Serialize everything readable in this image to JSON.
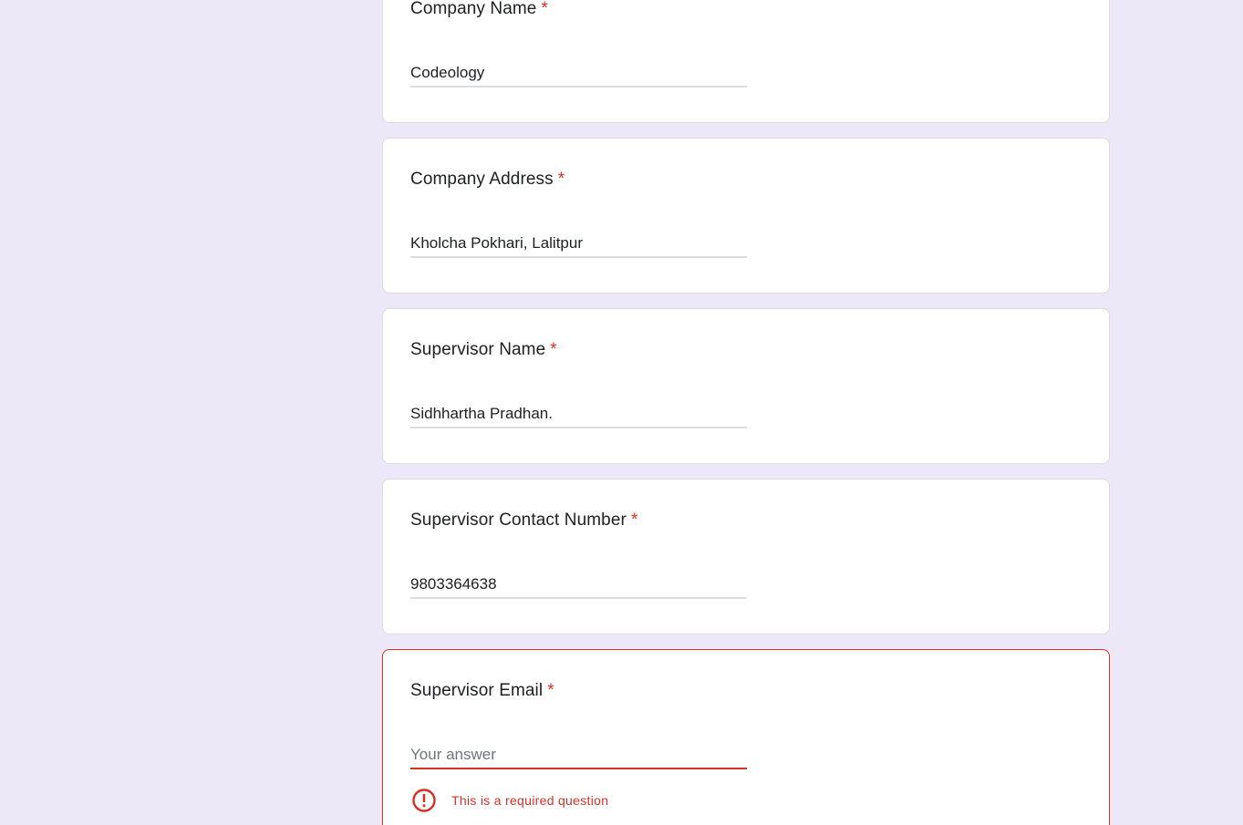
{
  "questions": [
    {
      "title": "Company Name",
      "required_mark": "*",
      "answer": "Codeology"
    },
    {
      "title": "Company Address",
      "required_mark": "*",
      "answer": "Kholcha Pokhari, Lalitpur"
    },
    {
      "title": "Supervisor Name",
      "required_mark": "*",
      "answer": "Sidhhartha Pradhan."
    },
    {
      "title": "Supervisor Contact Number",
      "required_mark": "*",
      "answer": "9803364638"
    },
    {
      "title": "Supervisor Email",
      "required_mark": "*",
      "placeholder": "Your answer",
      "error_message": "This is a required question"
    }
  ],
  "colors": {
    "page_background": "#ede8f7",
    "card_background": "#ffffff",
    "error": "#d93025",
    "text": "#202124",
    "placeholder": "#70757a"
  },
  "icons": {
    "error": "error-circle-exclamation-icon"
  }
}
